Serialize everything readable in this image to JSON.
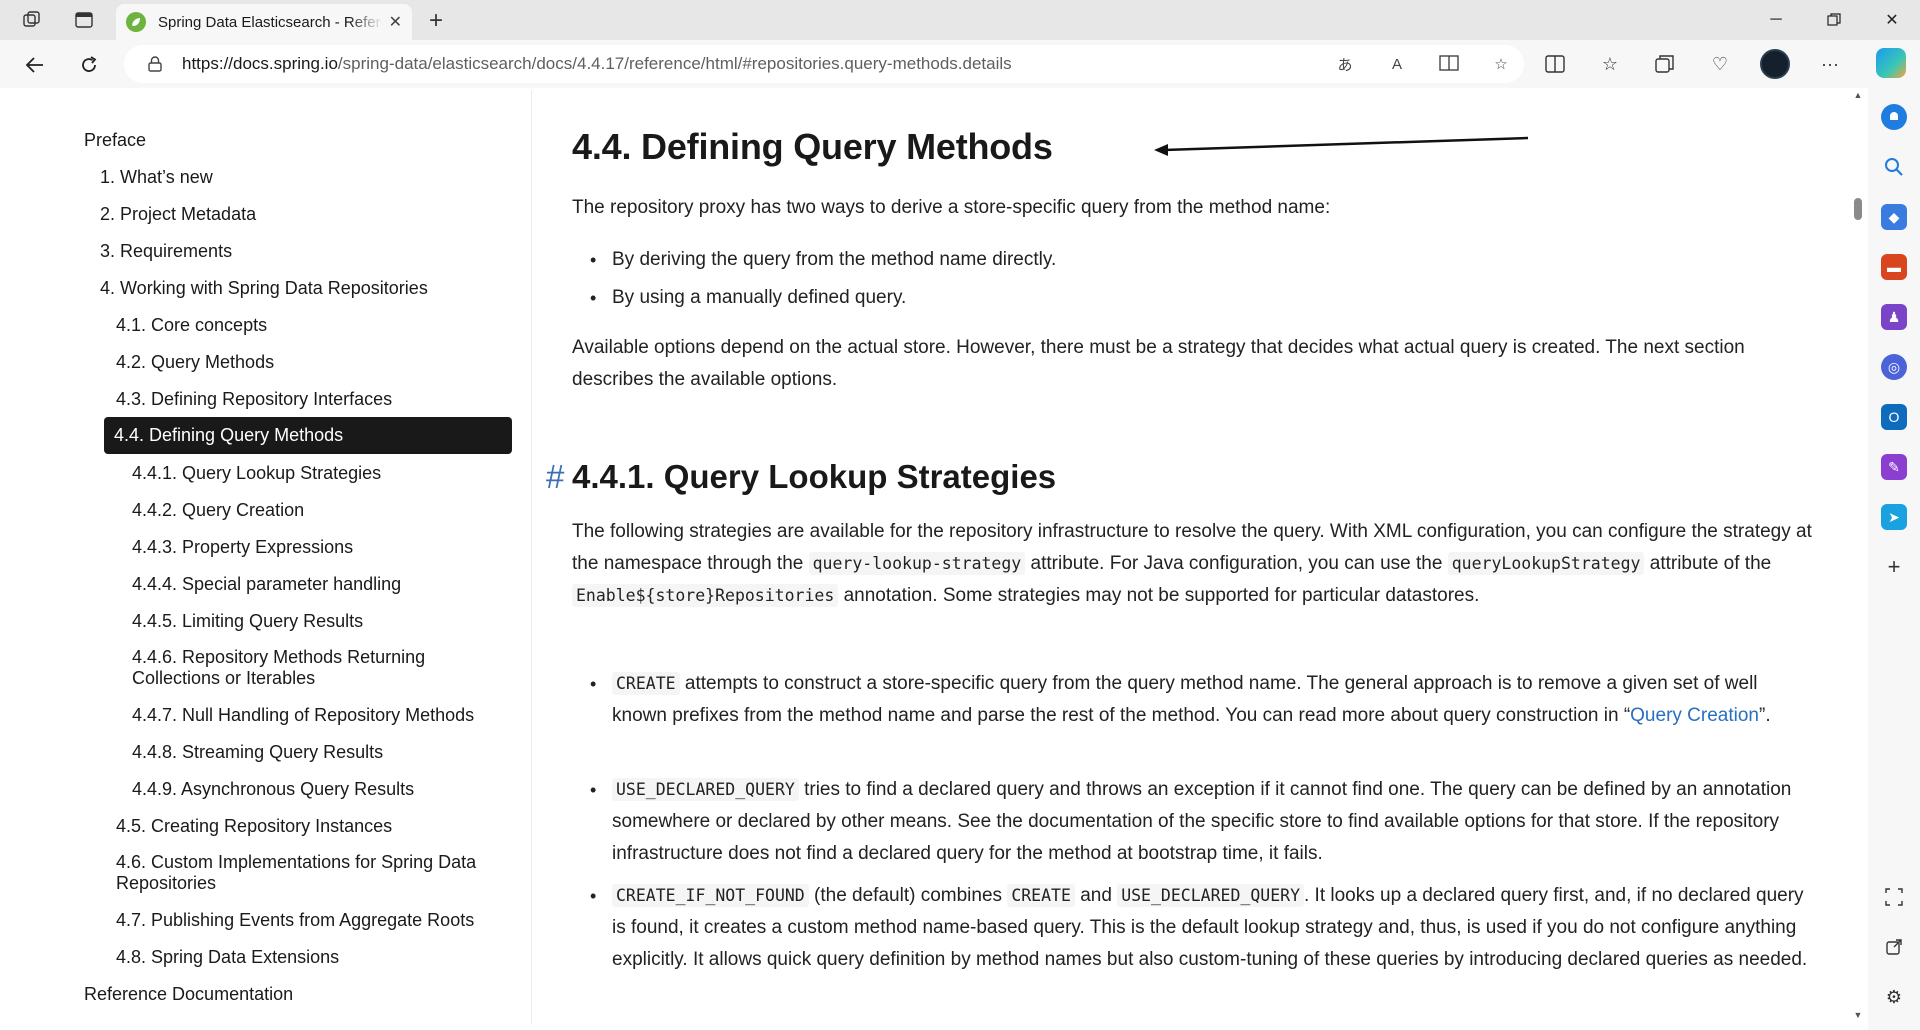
{
  "browser": {
    "tab_title": "Spring Data Elasticsearch - Reference Documentation",
    "url_host": "https://docs.spring.io",
    "url_path": "/spring-data/elasticsearch/docs/4.4.17/reference/html/#repositories.query-methods.details"
  },
  "toc": {
    "items": [
      {
        "label": "Preface"
      },
      {
        "label": "1. What’s new"
      },
      {
        "label": "2. Project Metadata"
      },
      {
        "label": "3. Requirements"
      },
      {
        "label": "4. Working with Spring Data Repositories"
      },
      {
        "label": "4.1. Core concepts"
      },
      {
        "label": "4.2. Query Methods"
      },
      {
        "label": "4.3. Defining Repository Interfaces"
      },
      {
        "label": "4.4. Defining Query Methods"
      },
      {
        "label": "4.4.1. Query Lookup Strategies"
      },
      {
        "label": "4.4.2. Query Creation"
      },
      {
        "label": "4.4.3. Property Expressions"
      },
      {
        "label": "4.4.4. Special parameter handling"
      },
      {
        "label": "4.4.5. Limiting Query Results"
      },
      {
        "label": "4.4.6. Repository Methods Returning Collections or Iterables"
      },
      {
        "label": "4.4.7. Null Handling of Repository Methods"
      },
      {
        "label": "4.4.8. Streaming Query Results"
      },
      {
        "label": "4.4.9. Asynchronous Query Results"
      },
      {
        "label": "4.5. Creating Repository Instances"
      },
      {
        "label": "4.6. Custom Implementations for Spring Data Repositories"
      },
      {
        "label": "4.7. Publishing Events from Aggregate Roots"
      },
      {
        "label": "4.8. Spring Data Extensions"
      },
      {
        "label": "Reference Documentation"
      }
    ]
  },
  "content": {
    "h1": "4.4. Defining Query Methods",
    "intro": "The repository proxy has two ways to derive a store-specific query from the method name:",
    "ways": [
      "By deriving the query from the method name directly.",
      "By using a manually defined query."
    ],
    "options": "Available options depend on the actual store. However, there must be a strategy that decides what actual query is created. The next section describes the available options.",
    "anchor": "#",
    "h2": "4.4.1. Query Lookup Strategies",
    "strategies_p1": "The following strategies are available for the repository infrastructure to resolve the query. With XML configuration, you can configure the strategy at the namespace through the",
    "code_lookup": "query-lookup-strategy",
    "strategies_p2": "attribute. For Java configuration, you can use the",
    "code_qls": "queryLookupStrategy",
    "strategies_p3": "attribute of the",
    "code_enable": "Enable${store}Repositories",
    "strategies_p4": "annotation. Some strategies may not be supported for particular datastores.",
    "create_code": "CREATE",
    "create_text": "attempts to construct a store-specific query from the query method name. The general approach is to remove a given set of well known prefixes from the method name and parse the rest of the method. You can read more about query construction in “",
    "create_link": "Query Creation",
    "create_end": "”.",
    "udq_code": "USE_DECLARED_QUERY",
    "udq_text": "tries to find a declared query and throws an exception if it cannot find one. The query can be defined by an annotation somewhere or declared by other means. See the documentation of the specific store to find available options for that store. If the repository infrastructure does not find a declared query for the method at bootstrap time, it fails.",
    "cinf_code": "CREATE_IF_NOT_FOUND",
    "cinf_t1": "(the default) combines",
    "cinf_code2": "CREATE",
    "cinf_t2": "and",
    "cinf_code3": "USE_DECLARED_QUERY",
    "cinf_t3": ". It looks up a declared query first, and, if no declared query is found, it creates a custom method name-based query. This is the default lookup strategy and, thus, is used if you do not configure anything explicitly. It allows quick query definition by method names but also custom-tuning of these queries by introducing declared queries as needed."
  },
  "colors": {
    "active_bg": "#191919",
    "link": "#2a6fbf",
    "anchor": "#3a6fb5",
    "spring_green": "#6db33f"
  },
  "icons": {
    "tab_actions": "tab-actions-icon",
    "vertical_tabs": "vertical-tabs-icon",
    "back": "back-arrow-icon",
    "refresh": "refresh-icon",
    "lock": "lock-icon",
    "favorite": "star-icon",
    "settings": "gear-icon"
  }
}
